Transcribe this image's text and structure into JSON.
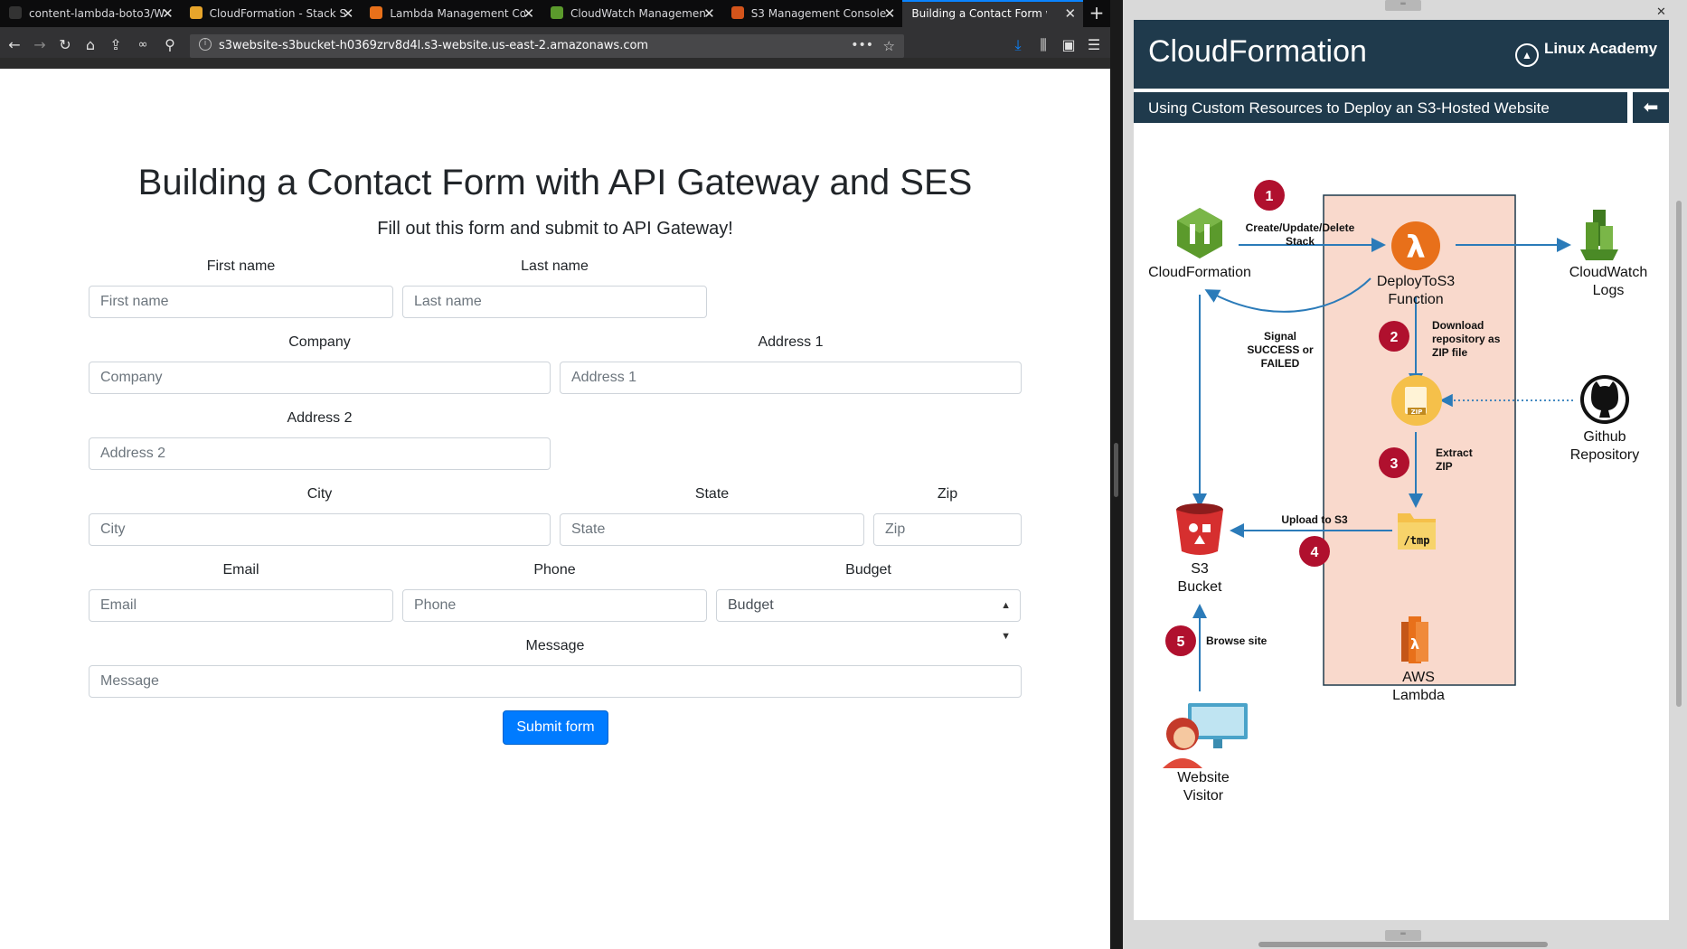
{
  "browser": {
    "tabs": [
      {
        "title": "content-lambda-boto3/W",
        "icon_color": "#333333"
      },
      {
        "title": "CloudFormation - Stack S",
        "icon_color": "#e7a52b"
      },
      {
        "title": "Lambda Management Con",
        "icon_color": "#e8701a"
      },
      {
        "title": "CloudWatch Management",
        "icon_color": "#5b9a2c"
      },
      {
        "title": "S3 Management Console",
        "icon_color": "#d3541b"
      },
      {
        "title": "Building a Contact Form with A",
        "icon_color": "#323234"
      }
    ],
    "active_tab": 5,
    "url": "s3website-s3bucket-h0369zrv8d4l.s3-website.us-east-2.amazonaws.com",
    "accent": "#0a84ff"
  },
  "form": {
    "title": "Building a Contact Form with API Gateway and SES",
    "subtitle": "Fill out this form and submit to API Gateway!",
    "first_name": {
      "label": "First name",
      "placeholder": "First name"
    },
    "last_name": {
      "label": "Last name",
      "placeholder": "Last name"
    },
    "company": {
      "label": "Company",
      "placeholder": "Company"
    },
    "address1": {
      "label": "Address 1",
      "placeholder": "Address 1"
    },
    "address2": {
      "label": "Address 2",
      "placeholder": "Address 2"
    },
    "city": {
      "label": "City",
      "placeholder": "City"
    },
    "state": {
      "label": "State",
      "placeholder": "State"
    },
    "zip": {
      "label": "Zip",
      "placeholder": "Zip"
    },
    "email": {
      "label": "Email",
      "placeholder": "Email"
    },
    "phone": {
      "label": "Phone",
      "placeholder": "Phone"
    },
    "budget": {
      "label": "Budget",
      "selected": "Budget"
    },
    "message": {
      "label": "Message",
      "placeholder": "Message"
    },
    "submit_label": "Submit form",
    "button_color": "#007bff"
  },
  "slide": {
    "title": "CloudFormation",
    "brand": "Linux Academy",
    "subtitle": "Using Custom Resources to Deploy an S3-Hosted Website",
    "header_color": "#1f3a4c",
    "diagram": {
      "nodes": {
        "cloudformation": "CloudFormation",
        "deploy_fn_1": "DeployToS3",
        "deploy_fn_2": "Function",
        "cw_1": "CloudWatch",
        "cw_2": "Logs",
        "github_1": "Github",
        "github_2": "Repository",
        "s3_1": "S3",
        "s3_2": "Bucket",
        "lambda_1": "AWS",
        "lambda_2": "Lambda",
        "visitor_1": "Website",
        "visitor_2": "Visitor",
        "zip_icon": "ZIP",
        "tmp_icon": "/tmp"
      },
      "steps": {
        "s1": "1",
        "s2": "2",
        "s3": "3",
        "s4": "4",
        "s5": "5"
      },
      "edge_labels": {
        "create_1": "Create/Update/Delete",
        "create_2": "Stack",
        "signal_1": "Signal",
        "signal_2": "SUCCESS or",
        "signal_3": "FAILED",
        "download_1": "Download",
        "download_2": "repository as",
        "download_3": "ZIP file",
        "extract_1": "Extract",
        "extract_2": "ZIP",
        "upload": "Upload to S3",
        "browse": "Browse site"
      },
      "colors": {
        "step_circle": "#b0102e",
        "arrow": "#2b7bb9",
        "lambda_box": "#f9d9cc",
        "lambda_border": "#1f3a4c"
      }
    }
  }
}
